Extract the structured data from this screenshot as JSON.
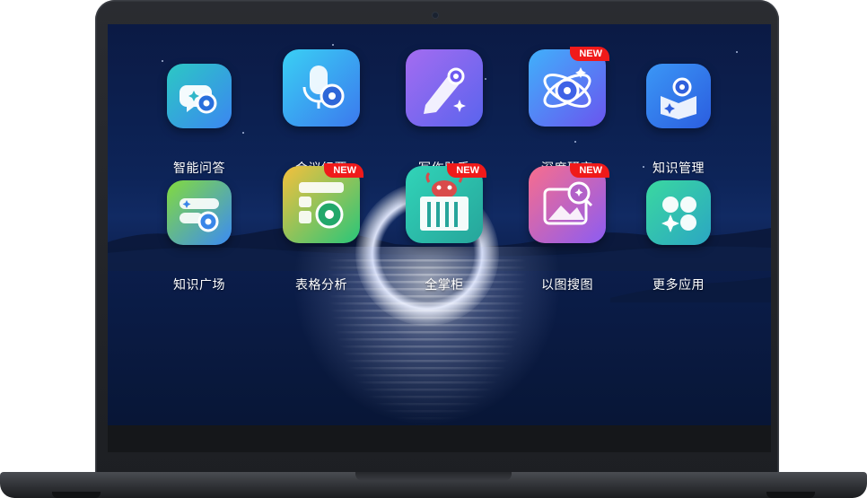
{
  "apps": [
    {
      "label": "智能问答",
      "badge": "",
      "icon": "chat-bubble-icon",
      "colors": [
        "#29c2c9",
        "#3c8bf0"
      ]
    },
    {
      "label": "会议纪要",
      "badge": "",
      "icon": "microphone-icon",
      "colors": [
        "#3ad0f4",
        "#3b79ee"
      ]
    },
    {
      "label": "写作助手",
      "badge": "",
      "icon": "pen-icon",
      "colors": [
        "#9a67f0",
        "#5b62ee"
      ]
    },
    {
      "label": "深度研究",
      "badge": "NEW",
      "icon": "atom-icon",
      "colors": [
        "#3fa7fb",
        "#6a55ef"
      ]
    },
    {
      "label": "知识管理",
      "badge": "",
      "icon": "book-icon",
      "colors": [
        "#3b92f5",
        "#2c5fe0"
      ]
    },
    {
      "label": "知识广场",
      "badge": "",
      "icon": "knowledge-square-icon",
      "colors": [
        "#7fd83f",
        "#3d8ef4"
      ]
    },
    {
      "label": "表格分析",
      "badge": "NEW",
      "icon": "table-icon",
      "colors": [
        "#f6c23e",
        "#28c678"
      ]
    },
    {
      "label": "全掌柜",
      "badge": "NEW",
      "icon": "cabinet-icon",
      "colors": [
        "#2fd0b7",
        "#27a89c"
      ]
    },
    {
      "label": "以图搜图",
      "badge": "NEW",
      "icon": "image-search-icon",
      "colors": [
        "#f76c8e",
        "#8e5cf2"
      ]
    },
    {
      "label": "更多应用",
      "badge": "",
      "icon": "grid-apps-icon",
      "colors": [
        "#3ad7a1",
        "#2aa7c2"
      ]
    }
  ]
}
